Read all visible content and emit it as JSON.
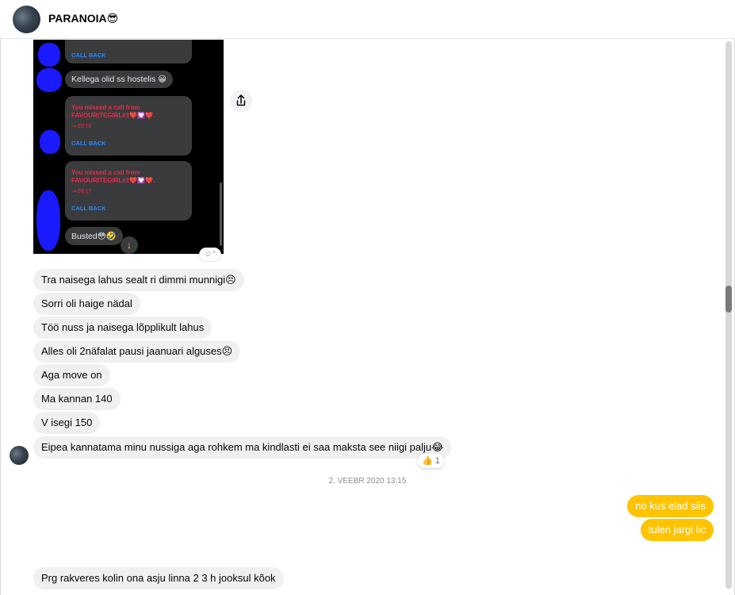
{
  "header": {
    "title": "PARANOIA😎"
  },
  "screenshot": {
    "call_back_top": "CALL BACK",
    "msg_hostel": "Kellega olid ss hostelis 😀",
    "missed_1": "You missed a call from",
    "missed_1_name": "FAVOURITEGIRL#1❤️💟❤️.",
    "missed_1_time": "↝ 09:16",
    "call_back_1": "CALL BACK",
    "missed_2": "You missed a call from",
    "missed_2_name": "FAVOURITEGIRL#1❤️💟❤️.",
    "missed_2_time": "↝ 09:17",
    "call_back_2": "CALL BACK",
    "msg_busted": "Busted😳🤣"
  },
  "messages_incoming": [
    "Tra naisega lahus sealt ri dimmi munnigi😣",
    "Sorri oli haige nädal",
    "Töö nuss ja naisega lõpplikult lahus",
    "Alles oli 2näfalat pausi jaanuari alguses😣",
    "Aga move on",
    "Ma kannan 140",
    "V isegi 150",
    "Eipea kannatama minu nussiga aga rohkem ma kindlasti ei saa maksta see niigi palju😂"
  ],
  "reaction": {
    "emoji": "👍",
    "count": "1"
  },
  "timestamp": "2. VEEBR 2020 13:15",
  "messages_outgoing": [
    "no kus elad siis",
    "tulen jargi lic"
  ],
  "last_incoming": "Prg rakveres kolin ona asju linna 2 3 h jooksul kõok",
  "colors": {
    "outgoing_bubble": "#ffc300",
    "incoming_bubble": "#f0f0f0",
    "missed_call_red": "#f0284a",
    "call_back_blue": "#2d88ff"
  },
  "icons": {
    "share": "share-icon",
    "add_reaction": "add-reaction-icon",
    "scroll_down": "arrow-down-icon"
  }
}
